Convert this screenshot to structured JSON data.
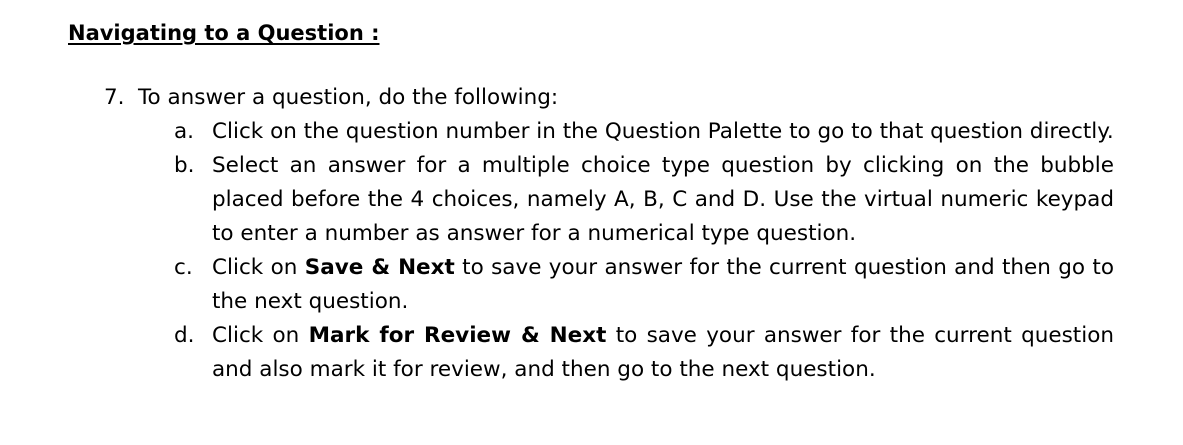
{
  "heading": "Navigating to a Question :",
  "step": {
    "number": "7.",
    "text": "To answer a question, do the following:"
  },
  "items": [
    {
      "letter": "a.",
      "text": "Click on the question number in the Question Palette to go to that question directly."
    },
    {
      "letter": "b.",
      "text": "Select an answer for a multiple choice type question by clicking on the bubble placed before the 4 choices, namely A, B, C and D. Use the virtual numeric keypad to enter a number as answer for a numerical type question."
    },
    {
      "letter": "c.",
      "pre": "Click on ",
      "bold": "Save & Next",
      "post": " to save your answer for the current question and then go to the next question."
    },
    {
      "letter": "d.",
      "pre": "Click on ",
      "bold": "Mark for Review & Next",
      "post": " to save your answer for the current question and also mark it for review, and then go to the next question."
    }
  ]
}
